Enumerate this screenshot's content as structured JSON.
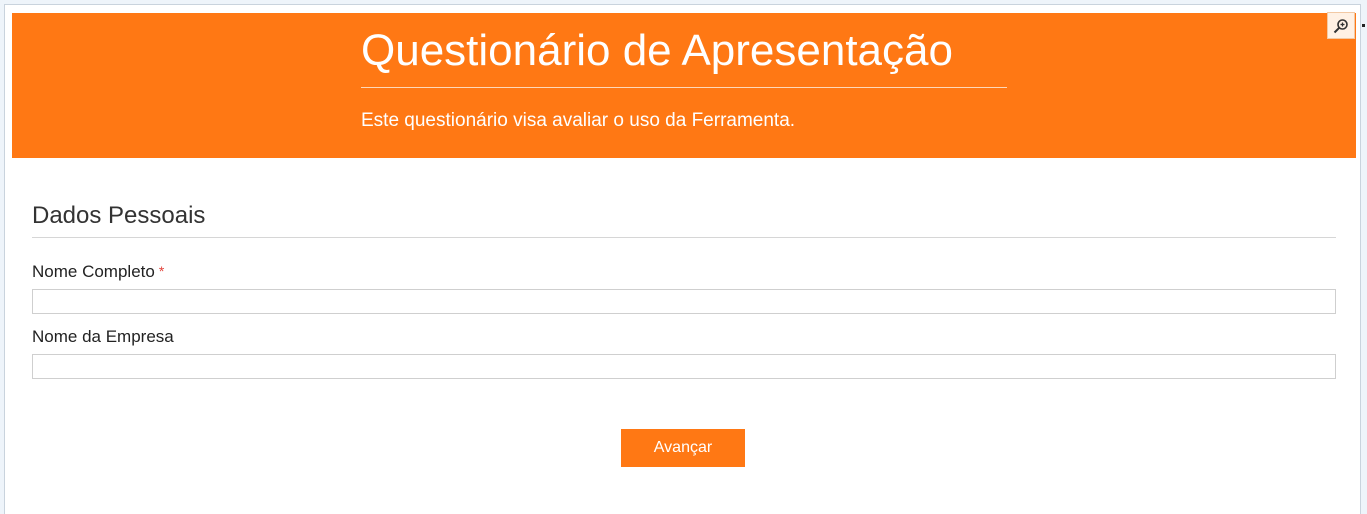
{
  "header": {
    "title": "Questionário de Apresentação",
    "subtitle": "Este questionário visa avaliar o uso da Ferramenta."
  },
  "toolbar": {
    "zoom_icon": "zoom-in-icon"
  },
  "section": {
    "title": "Dados Pessoais"
  },
  "fields": [
    {
      "label": "Nome Completo",
      "required_mark": "*",
      "value": "",
      "placeholder": ""
    },
    {
      "label": "Nome da Empresa",
      "value": "",
      "placeholder": ""
    }
  ],
  "actions": {
    "next_label": "Avançar"
  },
  "colors": {
    "accent": "#ff7814",
    "required": "#e2423a"
  }
}
